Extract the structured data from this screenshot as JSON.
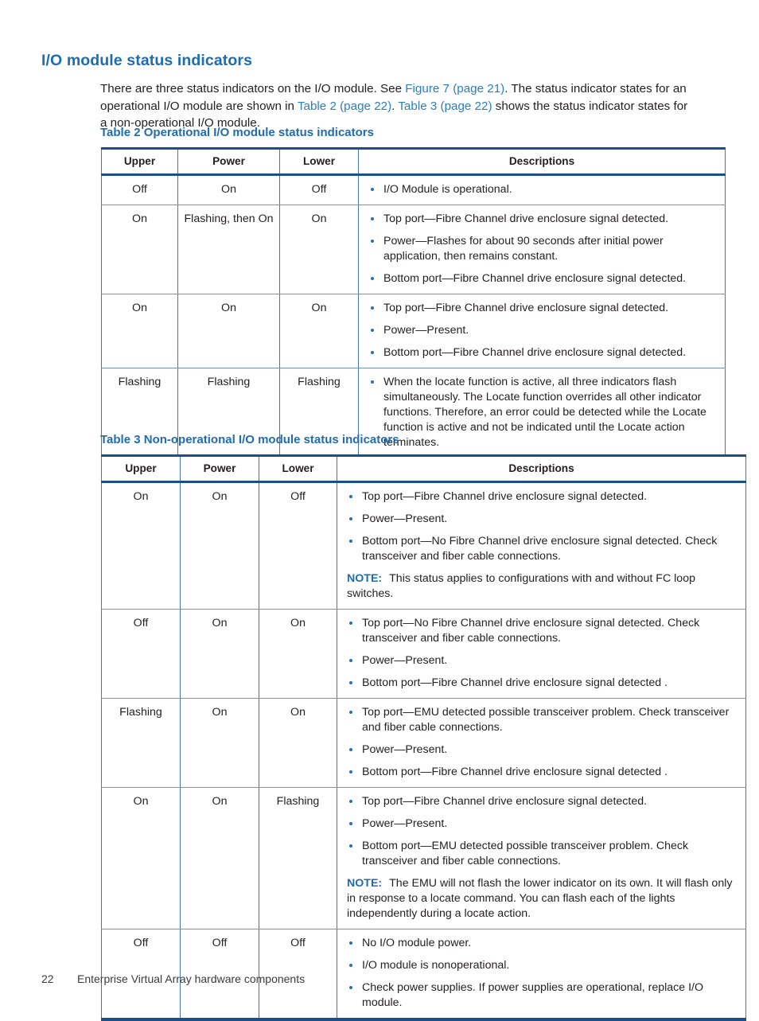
{
  "page": {
    "heading": "I/O module status indicators",
    "intro": {
      "part1": "There are three status indicators on the I/O module. See ",
      "link1": "Figure 7 (page 21)",
      "part2": ". The status indicator states for an operational I/O module are shown in ",
      "link2": "Table 2 (page 22)",
      "part3": ". ",
      "link3": "Table 3 (page 22)",
      "part4": " shows the status indicator states for a non-operational I/O module."
    },
    "footer": {
      "page_number": "22",
      "chapter_title": "Enterprise Virtual Array hardware components"
    },
    "colors": {
      "heading_blue": "#1f6cb0",
      "link_blue": "#2a7fc0",
      "rule_dark_blue": "#1b4f8a",
      "grid_blue": "#6e94c0",
      "bullet_blue": "#2a6ebb",
      "body_text": "#231f20"
    }
  },
  "table2": {
    "caption": "Table 2 Operational I/O module status indicators",
    "columns": [
      "Upper",
      "Power",
      "Lower",
      "Descriptions"
    ],
    "rows": [
      {
        "upper": "Off",
        "power": "On",
        "lower": "Off",
        "bullets": [
          "I/O Module is operational."
        ],
        "note": null
      },
      {
        "upper": "On",
        "power": "Flashing, then On",
        "lower": "On",
        "bullets": [
          "Top port—Fibre Channel drive enclosure signal detected.",
          "Power—Flashes for about 90 seconds after initial power application, then remains constant.",
          "Bottom port—Fibre Channel drive enclosure signal detected."
        ],
        "note": null
      },
      {
        "upper": "On",
        "power": "On",
        "lower": "On",
        "bullets": [
          "Top port—Fibre Channel drive enclosure signal detected.",
          "Power—Present.",
          "Bottom port—Fibre Channel drive enclosure signal detected."
        ],
        "note": null
      },
      {
        "upper": "Flashing",
        "power": "Flashing",
        "lower": "Flashing",
        "bullets": [
          "When the locate function is active, all three indicators flash simultaneously. The Locate function overrides all other indicator functions. Therefore, an error could be detected while the Locate function is active and not be indicated until the Locate action terminates."
        ],
        "note": null
      }
    ]
  },
  "table3": {
    "caption": "Table 3 Non-operational I/O module status indicators",
    "columns": [
      "Upper",
      "Power",
      "Lower",
      "Descriptions"
    ],
    "note_label": "NOTE:",
    "rows": [
      {
        "upper": "On",
        "power": "On",
        "lower": "Off",
        "bullets": [
          "Top port—Fibre Channel drive enclosure signal detected.",
          "Power—Present.",
          "Bottom port—No Fibre Channel drive enclosure signal detected. Check transceiver and fiber cable connections."
        ],
        "note": "This status applies to configurations with and without FC loop switches."
      },
      {
        "upper": "Off",
        "power": "On",
        "lower": "On",
        "bullets": [
          "Top port—No Fibre Channel drive enclosure signal detected. Check transceiver and fiber cable connections.",
          "Power—Present.",
          "Bottom port—Fibre Channel drive enclosure signal detected ."
        ],
        "note": null
      },
      {
        "upper": "Flashing",
        "power": "On",
        "lower": "On",
        "bullets": [
          "Top port—EMU detected possible transceiver problem. Check transceiver and fiber cable connections.",
          "Power—Present.",
          "Bottom port—Fibre Channel drive enclosure signal detected ."
        ],
        "note": null
      },
      {
        "upper": "On",
        "power": "On",
        "lower": "Flashing",
        "bullets": [
          "Top port—Fibre Channel drive enclosure signal detected.",
          "Power—Present.",
          "Bottom port—EMU detected possible transceiver problem. Check transceiver and fiber cable connections."
        ],
        "note": "The EMU will not flash the lower indicator on its own. It will flash only in response to a locate command. You can flash each of the lights independently during a locate action."
      },
      {
        "upper": "Off",
        "power": "Off",
        "lower": "Off",
        "bullets": [
          "No I/O module power.",
          "I/O module is nonoperational.",
          "Check power supplies. If power supplies are operational, replace I/O module."
        ],
        "note": null
      }
    ]
  }
}
